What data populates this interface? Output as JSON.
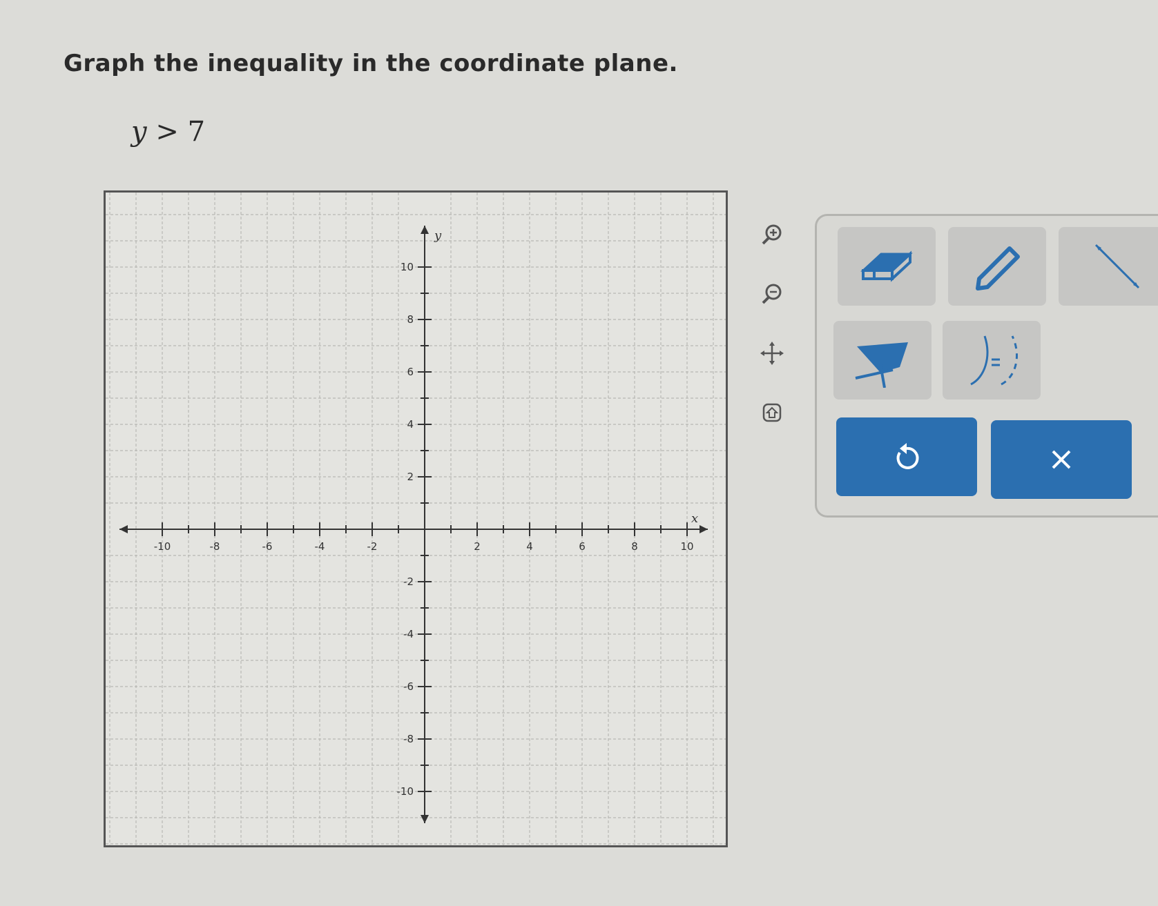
{
  "question": {
    "prompt": "Graph the inequality in the coordinate plane.",
    "inequality": {
      "variable": "y",
      "operator": ">",
      "value": "7"
    }
  },
  "graph": {
    "x_axis_label": "x",
    "y_axis_label": "y",
    "x_range": [
      -10,
      10
    ],
    "y_range": [
      -10,
      10
    ],
    "x_tick_labels": [
      "-10",
      "-8",
      "-6",
      "-4",
      "-2",
      "2",
      "4",
      "6",
      "8",
      "10"
    ],
    "y_tick_labels": [
      "10",
      "8",
      "6",
      "4",
      "2",
      "-2",
      "-4",
      "-6",
      "-8",
      "-10"
    ],
    "major_tick_step": 2,
    "minor_tick_step": 1,
    "grid": true
  },
  "side_tools": [
    {
      "name": "zoom-in",
      "icon": "zoom-in-icon"
    },
    {
      "name": "zoom-out",
      "icon": "zoom-out-icon"
    },
    {
      "name": "pan",
      "icon": "move-icon"
    },
    {
      "name": "home",
      "icon": "home-icon"
    }
  ],
  "drawing_tools": [
    {
      "name": "eraser",
      "icon": "eraser-icon"
    },
    {
      "name": "pencil",
      "icon": "pencil-icon"
    },
    {
      "name": "line",
      "icon": "line-icon"
    },
    {
      "name": "shade",
      "icon": "shade-region-icon"
    },
    {
      "name": "solid-dashed-toggle",
      "icon": "solid-dashed-icon"
    }
  ],
  "actions": [
    {
      "name": "undo",
      "icon": "undo-icon"
    },
    {
      "name": "clear",
      "icon": "close-icon"
    }
  ],
  "colors": {
    "page_background": "#dcdcd8",
    "action_button": "#2b6fb0",
    "tool_button": "#c6c6c4",
    "tool_icon": "#2b6fb0"
  }
}
